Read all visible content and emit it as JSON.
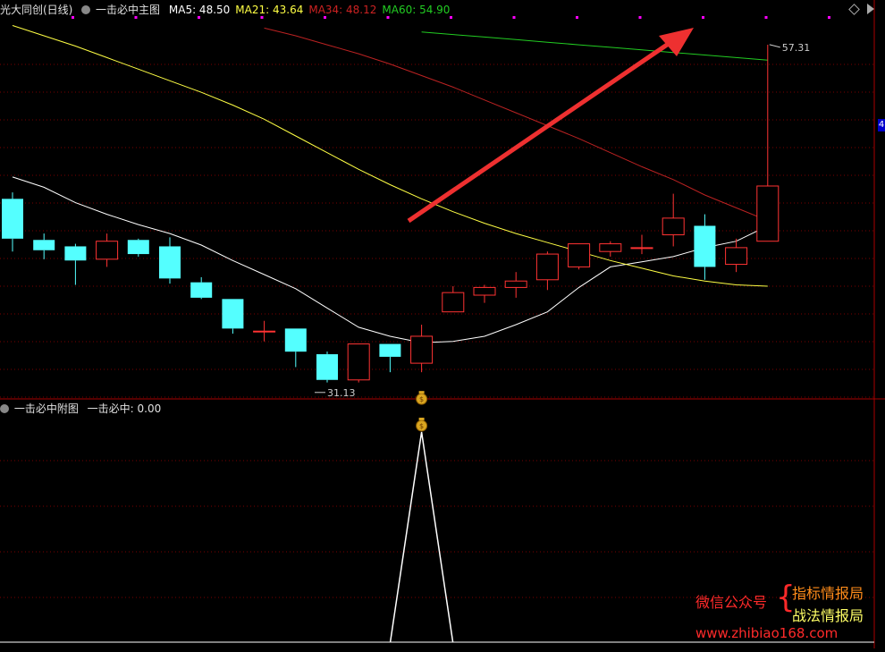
{
  "main_header": {
    "stock": "光大同创(日线)",
    "indicator": "一击必中主图",
    "ma": [
      {
        "label": "MA5: 48.50",
        "color": "#ffffff"
      },
      {
        "label": "MA21: 43.64",
        "color": "#ffff44"
      },
      {
        "label": "MA34: 48.12",
        "color": "#cc2222"
      },
      {
        "label": "MA60: 54.90",
        "color": "#22cc22"
      }
    ]
  },
  "sub_header": {
    "indicator": "一击必中附图",
    "value_label": "一击必中: 0.00"
  },
  "annotations": {
    "high_label": "57.31",
    "low_label": "31.13",
    "right_edge_label": "4"
  },
  "watermark": {
    "prefix": "微信公众号",
    "line1": "指标情报局",
    "line2": "战法情报局",
    "url": "www.zhibiao168.com"
  },
  "colors": {
    "up": "#ff3333",
    "down": "#54ffff",
    "grid": "#7a0000",
    "arrow": "#ee3030",
    "marker": "#ff00ff"
  },
  "chart_data": [
    {
      "type": "candlestick",
      "title": "光大同创(日线)",
      "price_range": [
        30,
        59
      ],
      "candles": [
        {
          "o": 45.3,
          "h": 45.8,
          "l": 41.2,
          "c": 42.2
        },
        {
          "o": 42.1,
          "h": 42.6,
          "l": 40.6,
          "c": 41.3
        },
        {
          "o": 41.6,
          "h": 41.8,
          "l": 38.6,
          "c": 40.5
        },
        {
          "o": 40.6,
          "h": 42.6,
          "l": 40.0,
          "c": 42.0
        },
        {
          "o": 42.1,
          "h": 42.2,
          "l": 40.8,
          "c": 41.0
        },
        {
          "o": 41.6,
          "h": 42.3,
          "l": 38.7,
          "c": 39.1
        },
        {
          "o": 38.8,
          "h": 39.2,
          "l": 37.5,
          "c": 37.6
        },
        {
          "o": 37.5,
          "h": 37.5,
          "l": 34.8,
          "c": 35.2
        },
        {
          "o": 35.0,
          "h": 35.8,
          "l": 34.2,
          "c": 35.0
        },
        {
          "o": 35.2,
          "h": 35.2,
          "l": 32.2,
          "c": 33.4
        },
        {
          "o": 33.2,
          "h": 33.4,
          "l": 31.0,
          "c": 31.2
        },
        {
          "o": 31.2,
          "h": 34.0,
          "l": 31.0,
          "c": 34.0
        },
        {
          "o": 34.0,
          "h": 34.0,
          "l": 31.8,
          "c": 33.0
        },
        {
          "o": 32.5,
          "h": 35.5,
          "l": 31.8,
          "c": 34.6
        },
        {
          "o": 36.5,
          "h": 38.5,
          "l": 36.5,
          "c": 38.0
        },
        {
          "o": 37.8,
          "h": 38.6,
          "l": 37.2,
          "c": 38.4
        },
        {
          "o": 38.4,
          "h": 39.6,
          "l": 37.6,
          "c": 38.9
        },
        {
          "o": 39.0,
          "h": 41.2,
          "l": 38.2,
          "c": 41.0
        },
        {
          "o": 40.0,
          "h": 41.8,
          "l": 39.8,
          "c": 41.8
        },
        {
          "o": 41.2,
          "h": 42.0,
          "l": 40.8,
          "c": 41.8
        },
        {
          "o": 41.5,
          "h": 42.5,
          "l": 41.0,
          "c": 41.5
        },
        {
          "o": 42.5,
          "h": 45.7,
          "l": 41.6,
          "c": 43.8
        },
        {
          "o": 43.2,
          "h": 44.1,
          "l": 39.0,
          "c": 40.0
        },
        {
          "o": 40.2,
          "h": 42.2,
          "l": 39.6,
          "c": 41.5
        },
        {
          "o": 42.0,
          "h": 57.3,
          "l": 42.0,
          "c": 46.3
        }
      ],
      "series": [
        {
          "name": "MA5",
          "values": [
            47.0,
            46.2,
            45.0,
            44.1,
            43.3,
            42.6,
            41.7,
            40.5,
            39.4,
            38.3,
            36.8,
            35.3,
            34.6,
            34.1,
            34.2,
            34.6,
            35.5,
            36.5,
            38.4,
            40.0,
            40.4,
            40.8,
            41.5,
            42.0,
            43.2
          ]
        },
        {
          "name": "MA21",
          "values": [
            58.8,
            58.0,
            57.2,
            56.3,
            55.4,
            54.5,
            53.6,
            52.6,
            51.5,
            50.2,
            48.9,
            47.6,
            46.4,
            45.3,
            44.3,
            43.4,
            42.6,
            41.9,
            41.2,
            40.5,
            39.9,
            39.3,
            38.9,
            38.6,
            38.5
          ]
        },
        {
          "name": "MA34",
          "values": [
            null,
            null,
            null,
            null,
            null,
            null,
            null,
            null,
            58.6,
            58.0,
            57.3,
            56.6,
            55.8,
            54.9,
            54.0,
            53.0,
            52.0,
            51.0,
            50.0,
            48.9,
            47.8,
            46.8,
            45.6,
            44.6,
            43.6
          ]
        },
        {
          "name": "MA60",
          "values": [
            null,
            null,
            null,
            null,
            null,
            null,
            null,
            null,
            null,
            null,
            null,
            null,
            null,
            58.3,
            58.1,
            57.9,
            57.7,
            57.5,
            57.3,
            57.1,
            56.9,
            56.7,
            56.5,
            56.3,
            56.1
          ]
        }
      ],
      "high": 57.31,
      "low": 31.13,
      "signal_index": 13
    },
    {
      "type": "line",
      "title": "一击必中附图",
      "series": [
        {
          "name": "一击必中",
          "values": [
            0,
            0,
            0,
            0,
            0,
            0,
            0,
            0,
            0,
            0,
            0,
            0,
            0,
            1,
            0,
            0,
            0,
            0,
            0,
            0,
            0,
            0,
            0,
            0,
            0
          ]
        }
      ],
      "current_value": 0.0
    }
  ]
}
